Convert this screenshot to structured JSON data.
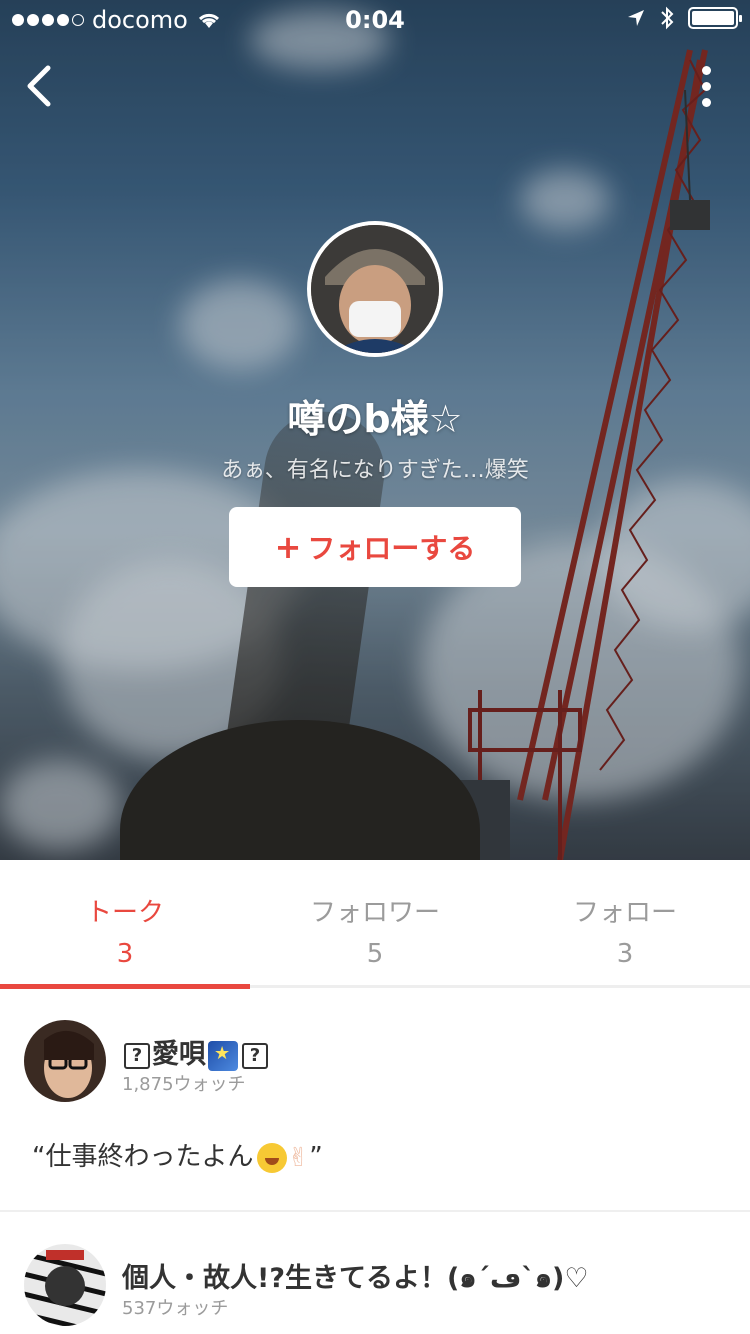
{
  "status_bar": {
    "carrier": "docomo",
    "time": "0:04"
  },
  "header": {
    "back_icon": "chevron-left-icon",
    "more_icon": "vertical-ellipsis-icon"
  },
  "profile": {
    "name": "噂のb様☆",
    "bio": "あぁ、有名になりすぎた…爆笑",
    "follow_button": "フォローする",
    "follow_plus": "+"
  },
  "tabs": [
    {
      "label": "トーク",
      "count": "3",
      "active": true
    },
    {
      "label": "フォロワー",
      "count": "5",
      "active": false
    },
    {
      "label": "フォロー",
      "count": "3",
      "active": false
    }
  ],
  "posts": [
    {
      "name_prefix": "?",
      "name_text": "愛唄",
      "name_suffix": "?",
      "watch": "1,875ウォッチ",
      "body_text": "“仕事終わったよん",
      "body_close": "”"
    },
    {
      "name_text": "個人・故人!?生きてるよ！(๑´ڡ`๑)♡",
      "watch": "537ウォッチ"
    }
  ],
  "colors": {
    "accent": "#e9483f",
    "text_gray": "#9b9b9b"
  }
}
